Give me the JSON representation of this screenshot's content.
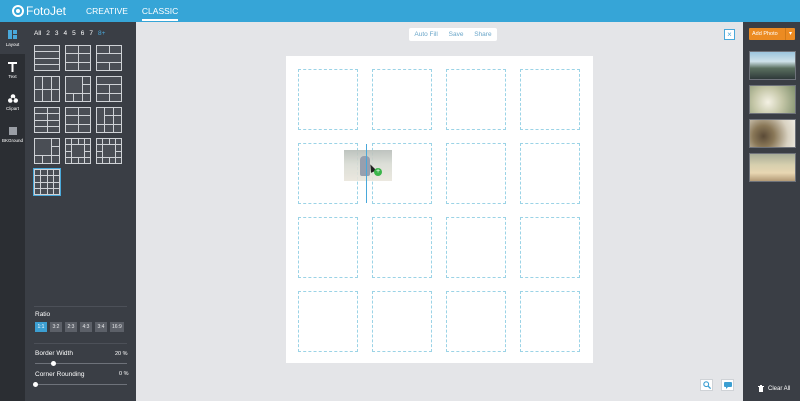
{
  "app": {
    "logo_text": "FotoJet"
  },
  "nav": {
    "tabs": [
      {
        "label": "CREATIVE"
      },
      {
        "label": "CLASSIC"
      }
    ]
  },
  "rail": {
    "items": [
      {
        "label": "Layout"
      },
      {
        "label": "Text"
      },
      {
        "label": "Clipart"
      },
      {
        "label": "BKGround"
      }
    ]
  },
  "filters": {
    "items": [
      "All",
      "2",
      "3",
      "4",
      "5",
      "6",
      "7",
      "8+"
    ],
    "selected": "8+"
  },
  "ratio": {
    "label": "Ratio",
    "options": [
      "1:1",
      "3:2",
      "2:3",
      "4:3",
      "3:4",
      "16:9"
    ],
    "selected": "1:1"
  },
  "border_width": {
    "label": "Border Width",
    "value": "20 %",
    "level": 0.2
  },
  "corner_rounding": {
    "label": "Corner Rounding",
    "value": "0 %",
    "level": 0.0
  },
  "toolbar": {
    "autofill": "Auto Fill",
    "save": "Save",
    "share": "Share"
  },
  "close": {
    "glyph": "×"
  },
  "right": {
    "add_photo": "Add Photo",
    "clear_all": "Clear All"
  },
  "colors": {
    "accent": "#36a5d7",
    "add_photo": "#ec8b22",
    "panel": "#3a3e45"
  }
}
